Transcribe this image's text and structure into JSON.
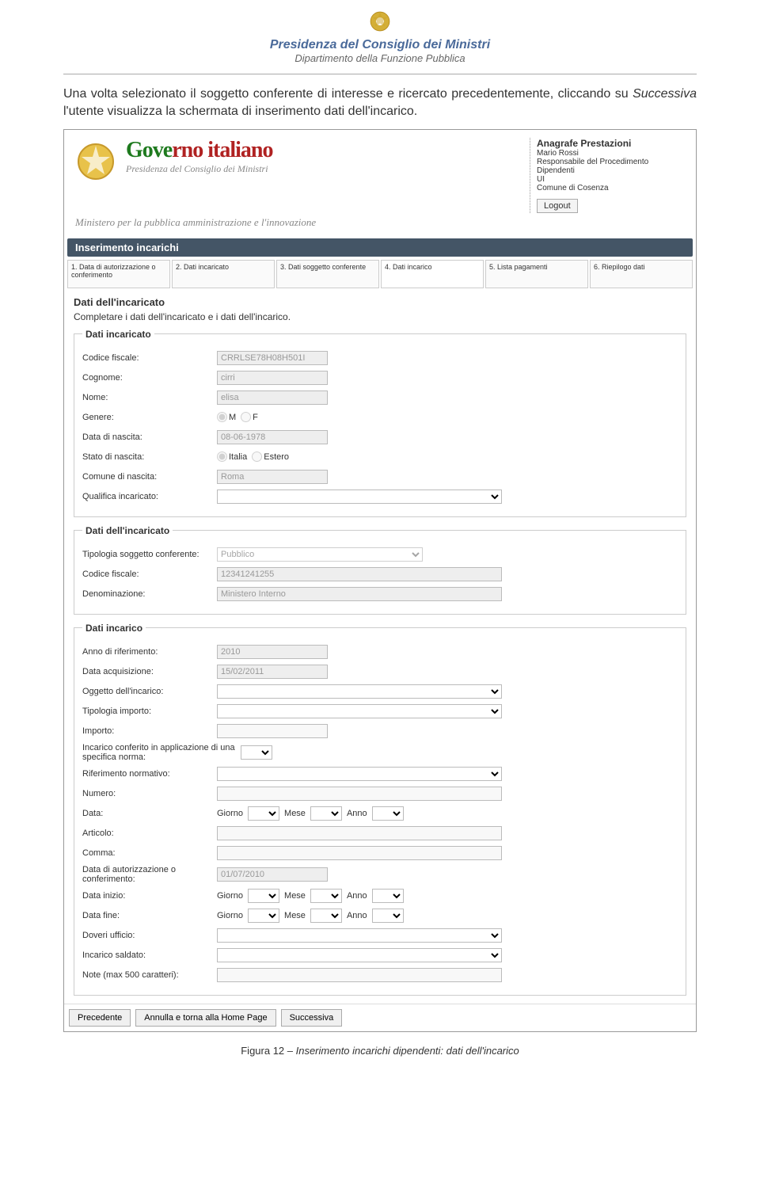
{
  "doc_header": {
    "line1": "Presidenza del Consiglio dei Ministri",
    "line2": "Dipartimento della Funzione Pubblica"
  },
  "intro": {
    "p1_a": "Una volta selezionato il soggetto conferente di interesse e ricercato precedentemente, cliccando su ",
    "p1_em": "Successiva",
    "p1_b": " l'utente visualizza la schermata di inserimento dati dell'incarico."
  },
  "app": {
    "brand": {
      "gov_g": "Gove",
      "gov_r1": "rno ita",
      "gov_r2": "liano",
      "sub": "Presidenza del Consiglio dei Ministri"
    },
    "tagline": "Ministero per la pubblica amministrazione e l'innovazione",
    "info": {
      "title": "Anagrafe Prestazioni",
      "user": "Mario Rossi",
      "role": "Responsabile del Procedimento Dipendenti",
      "org1": "UI",
      "org2": "Comune di Cosenza",
      "logout": "Logout"
    },
    "section": "Inserimento incarichi",
    "steps": [
      "1. Data di autorizzazione o conferimento",
      "2. Dati incaricato",
      "3. Dati soggetto conferente",
      "4. Dati incarico",
      "5. Lista pagamenti",
      "6. Riepilogo dati"
    ],
    "block1": {
      "title": "Dati dell'incaricato",
      "sub": "Completare i dati dell'incaricato e i dati dell'incarico.",
      "legend": "Dati incaricato",
      "cf_label": "Codice fiscale:",
      "cf_val": "CRRLSE78H08H501I",
      "cognome_label": "Cognome:",
      "cognome_val": "cirri",
      "nome_label": "Nome:",
      "nome_val": "elisa",
      "genere_label": "Genere:",
      "genere_m": "M",
      "genere_f": "F",
      "dn_label": "Data di nascita:",
      "dn_val": "08-06-1978",
      "sn_label": "Stato di nascita:",
      "sn_it": "Italia",
      "sn_es": "Estero",
      "cn_label": "Comune di nascita:",
      "cn_val": "Roma",
      "qi_label": "Qualifica incaricato:"
    },
    "block2": {
      "legend": "Dati dell'incaricato",
      "tsc_label": "Tipologia soggetto conferente:",
      "tsc_val": "Pubblico",
      "cf_label": "Codice fiscale:",
      "cf_val": "12341241255",
      "den_label": "Denominazione:",
      "den_val": "Ministero Interno"
    },
    "block3": {
      "legend": "Dati incarico",
      "anno_label": "Anno di riferimento:",
      "anno_val": "2010",
      "da_label": "Data acquisizione:",
      "da_val": "15/02/2011",
      "oi_label": "Oggetto dell'incarico:",
      "ti_label": "Tipologia importo:",
      "imp_label": "Importo:",
      "icn_label": "Incarico conferito in applicazione di una specifica norma:",
      "rn_label": "Riferimento normativo:",
      "num_label": "Numero:",
      "data_label": "Data:",
      "giorno": "Giorno",
      "mese": "Mese",
      "anno": "Anno",
      "art_label": "Articolo:",
      "comma_label": "Comma:",
      "dac_label": "Data di autorizzazione o conferimento:",
      "dac_val": "01/07/2010",
      "di_label": "Data inizio:",
      "df_label": "Data fine:",
      "du_label": "Doveri ufficio:",
      "is_label": "Incarico saldato:",
      "note_label": "Note (max 500 caratteri):"
    },
    "buttons": {
      "prev": "Precedente",
      "cancel": "Annulla e torna alla Home Page",
      "next": "Successiva"
    }
  },
  "caption": {
    "pre": "Figura 12 – ",
    "em": "Inserimento incarichi dipendenti: dati dell'incarico"
  }
}
